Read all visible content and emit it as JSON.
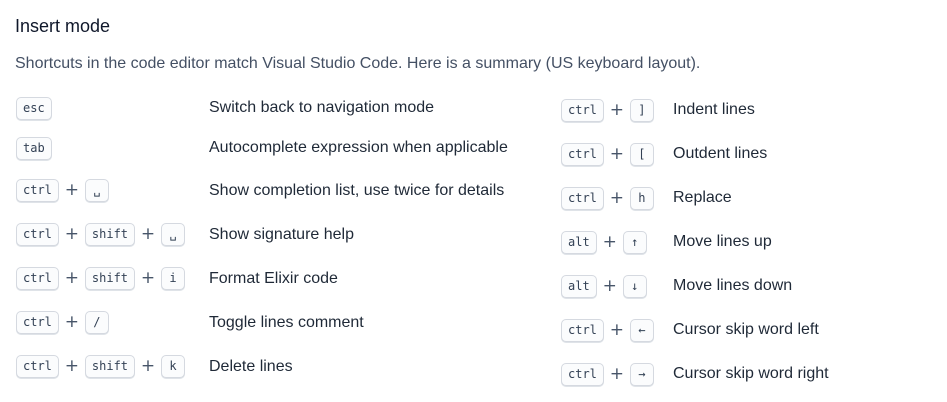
{
  "header": {
    "title": "Insert mode",
    "subtitle": "Shortcuts in the code editor match Visual Studio Code. Here is a summary (US keyboard layout)."
  },
  "plus_symbol": "+",
  "left_shortcuts": [
    {
      "keys": [
        "esc"
      ],
      "description": "Switch back to navigation mode"
    },
    {
      "keys": [
        "tab"
      ],
      "description": "Autocomplete expression when applicable"
    },
    {
      "keys": [
        "ctrl",
        "␣"
      ],
      "description": "Show completion list, use twice for details"
    },
    {
      "keys": [
        "ctrl",
        "shift",
        "␣"
      ],
      "description": "Show signature help"
    },
    {
      "keys": [
        "ctrl",
        "shift",
        "i"
      ],
      "description": "Format Elixir code"
    },
    {
      "keys": [
        "ctrl",
        "/"
      ],
      "description": "Toggle lines comment"
    },
    {
      "keys": [
        "ctrl",
        "shift",
        "k"
      ],
      "description": "Delete lines"
    }
  ],
  "right_shortcuts": [
    {
      "keys": [
        "ctrl",
        "]"
      ],
      "description": "Indent lines"
    },
    {
      "keys": [
        "ctrl",
        "["
      ],
      "description": "Outdent lines"
    },
    {
      "keys": [
        "ctrl",
        "h"
      ],
      "description": "Replace"
    },
    {
      "keys": [
        "alt",
        "↑"
      ],
      "description": "Move lines up"
    },
    {
      "keys": [
        "alt",
        "↓"
      ],
      "description": "Move lines down"
    },
    {
      "keys": [
        "ctrl",
        "←"
      ],
      "description": "Cursor skip word left"
    },
    {
      "keys": [
        "ctrl",
        "→"
      ],
      "description": "Cursor skip word right"
    }
  ]
}
